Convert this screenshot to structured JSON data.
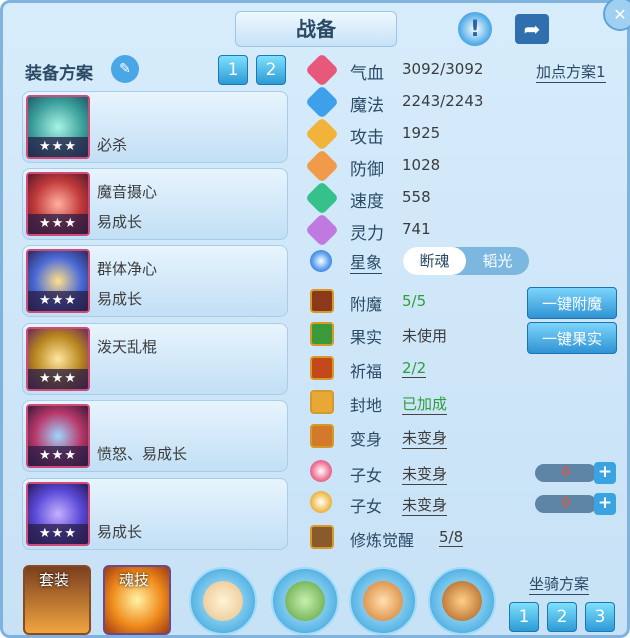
{
  "title": "战备",
  "equip_scheme": {
    "label": "装备方案",
    "buttons": [
      "1",
      "2"
    ],
    "items": [
      {
        "text1": "",
        "text2": "必杀",
        "stars": "★★★"
      },
      {
        "text1": "魔音摄心",
        "text2": "易成长",
        "stars": "★★★"
      },
      {
        "text1": "群体净心",
        "text2": "易成长",
        "stars": "★★★"
      },
      {
        "text1": "泼天乱棍",
        "text2": "",
        "stars": "★★★"
      },
      {
        "text1": "",
        "text2": "愤怒、易成长",
        "stars": "★★★"
      },
      {
        "text1": "",
        "text2": "易成长",
        "stars": "★★★"
      }
    ]
  },
  "add_point_plan": "加点方案1",
  "stats": [
    {
      "label": "气血",
      "value": "3092/3092",
      "icon": "heart-icon",
      "color": "#e8587a"
    },
    {
      "label": "魔法",
      "value": "2243/2243",
      "icon": "mana-icon",
      "color": "#3da0ea"
    },
    {
      "label": "攻击",
      "value": "1925",
      "icon": "sword-icon",
      "color": "#f2b33a"
    },
    {
      "label": "防御",
      "value": "1028",
      "icon": "shield-icon",
      "color": "#f09a4a"
    },
    {
      "label": "速度",
      "value": "558",
      "icon": "speed-icon",
      "color": "#34c28a"
    },
    {
      "label": "灵力",
      "value": "741",
      "icon": "spirit-icon",
      "color": "#c07adf"
    }
  ],
  "star": {
    "label": "星象",
    "options": [
      "断魂",
      "韬光"
    ],
    "selected": "断魂"
  },
  "buffs": [
    {
      "label": "附魔",
      "value": "5/5",
      "color": "#2e9e3a"
    },
    {
      "label": "果实",
      "value": "未使用",
      "color": "#3c3c3c"
    },
    {
      "label": "祈福",
      "value": "2/2",
      "color": "#2e9e3a"
    },
    {
      "label": "封地",
      "value": "已加成",
      "color": "#2e9e3a"
    },
    {
      "label": "变身",
      "value": "未变身",
      "color": "#3c3c3c"
    },
    {
      "label": "子女",
      "value": "未变身",
      "color": "#3c3c3c",
      "count": "0"
    },
    {
      "label": "子女",
      "value": "未变身",
      "color": "#3c3c3c",
      "count": "0"
    },
    {
      "label": "修炼觉醒",
      "value": "5/8",
      "color": "#3c3c3c"
    }
  ],
  "actions": {
    "enchant": "一键附魔",
    "fruit": "一键果实"
  },
  "bottom": {
    "suit": "套装",
    "soul": "魂技",
    "mount_plan": "坐骑方案",
    "mount_buttons": [
      "1",
      "2",
      "3"
    ]
  }
}
